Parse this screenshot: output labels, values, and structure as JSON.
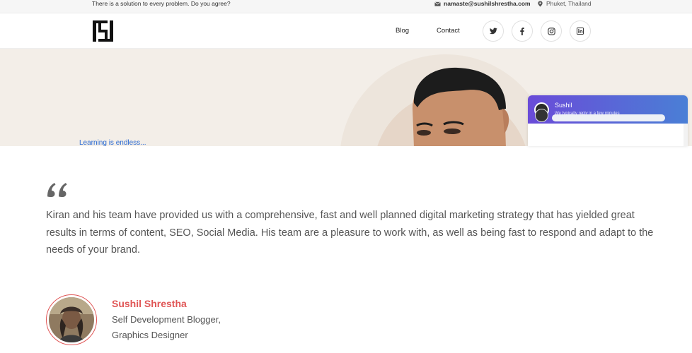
{
  "topbar": {
    "tagline": "There is a solution to every problem. Do you agree?",
    "email": "namaste@sushilshrestha.com",
    "location": "Phuket, Thailand",
    "email_icon": "envelope-icon",
    "location_icon": "map-pin-icon"
  },
  "nav": {
    "logo_icon": "ss-monogram-logo",
    "links": [
      {
        "label": "Blog"
      },
      {
        "label": "Contact"
      }
    ],
    "social": [
      {
        "icon": "twitter-icon"
      },
      {
        "icon": "facebook-icon"
      },
      {
        "icon": "instagram-icon"
      },
      {
        "icon": "linkedin-icon"
      }
    ]
  },
  "hero": {
    "tagline": "Learning is endless..."
  },
  "chat": {
    "name": "Sushil",
    "subtitle": "We typically reply in a few minutes",
    "accent": "#5a66d8"
  },
  "testimonial": {
    "quote": "Kiran and his team have provided us with a comprehensive, fast and well planned digital marketing strategy that has yielded great results in terms of content, SEO, Social Media. His team are a pleasure to work with, as well as being fast to respond and adapt to the needs of your brand.",
    "author_name": "Sushil Shrestha",
    "author_role_line1": "Self Development Blogger,",
    "author_role_line2": "Graphics Designer",
    "name_color": "#e05656"
  }
}
